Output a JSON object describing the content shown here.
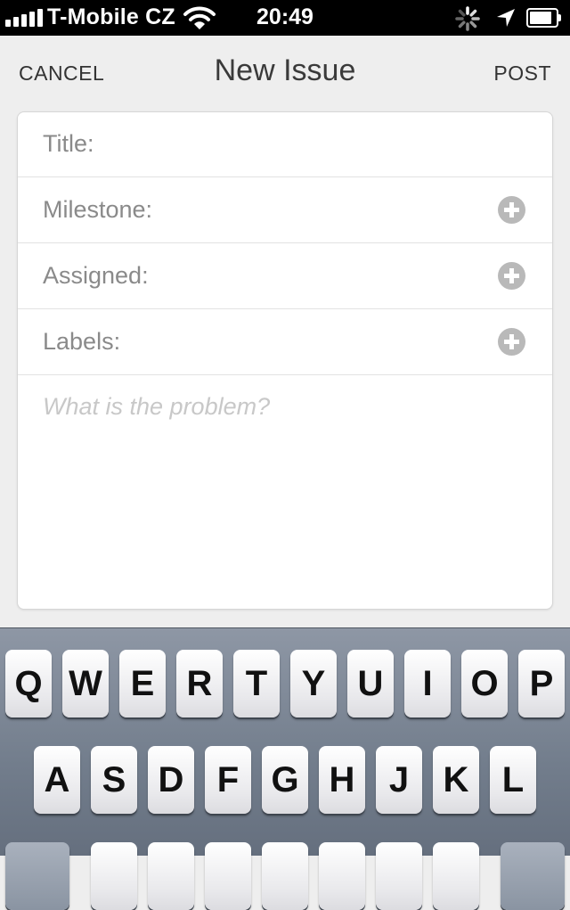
{
  "status_bar": {
    "carrier": "T-Mobile CZ",
    "time": "20:49",
    "signal_bars": 5,
    "wifi": "wifi-icon",
    "activity": "spinner-icon",
    "location": "location-arrow-icon",
    "battery_level": 0.85
  },
  "nav": {
    "cancel_label": "CANCEL",
    "title": "New Issue",
    "post_label": "POST"
  },
  "form": {
    "title_label": "Title:",
    "milestone_label": "Milestone:",
    "assigned_label": "Assigned:",
    "labels_label": "Labels:",
    "add_icon": "plus-circle-icon",
    "body_placeholder": "What is the problem?"
  },
  "keyboard": {
    "row1": [
      "Q",
      "W",
      "E",
      "R",
      "T",
      "Y",
      "U",
      "I",
      "O",
      "P"
    ],
    "row2": [
      "A",
      "S",
      "D",
      "F",
      "G",
      "H",
      "J",
      "K",
      "L"
    ]
  },
  "colors": {
    "status_bar_bg": "#000000",
    "app_bg": "#eeeeee",
    "card_bg": "#ffffff",
    "label_gray": "#8a8a8a",
    "plus_gray": "#b9b9b9",
    "keyboard_bg": "#7a8493"
  }
}
